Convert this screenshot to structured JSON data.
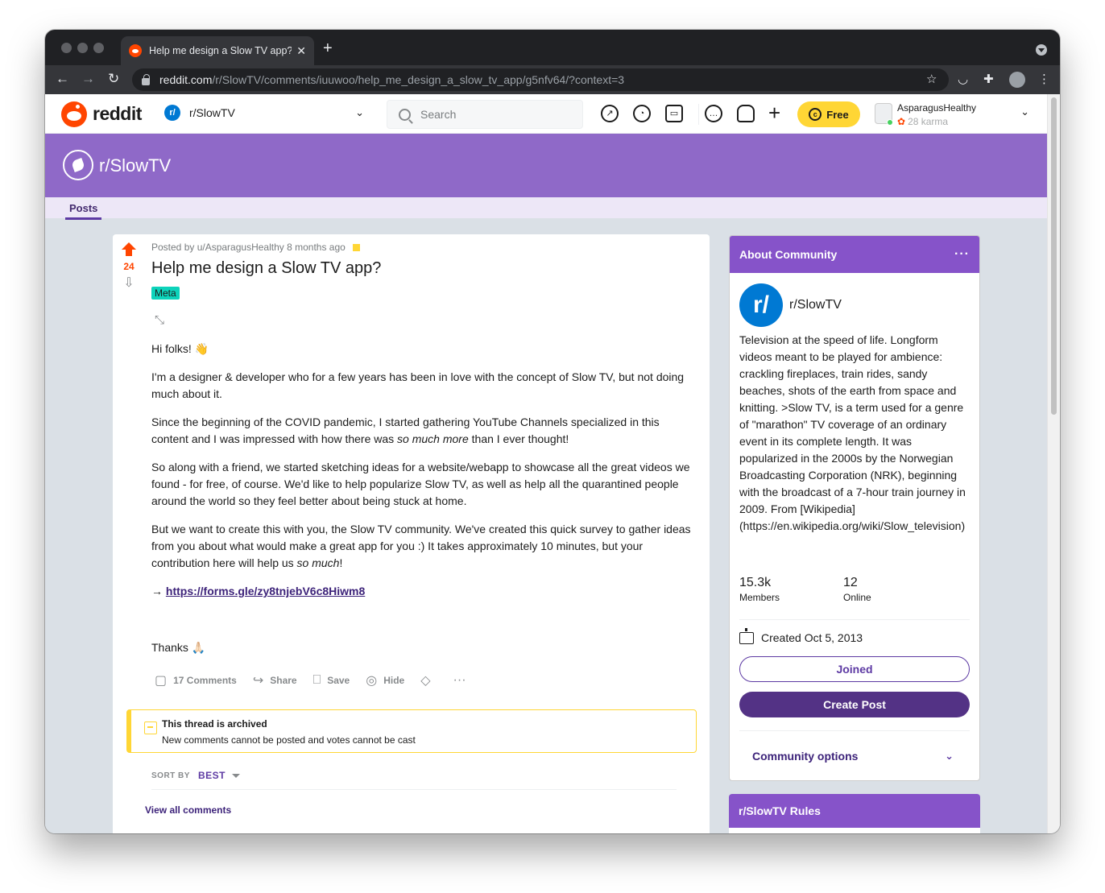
{
  "browser": {
    "tab_title": "Help me design a Slow TV app?",
    "url_host": "reddit.com",
    "url_path": "/r/SlowTV/comments/iuuwoo/help_me_design_a_slow_tv_app/g5nfv64/?context=3"
  },
  "header": {
    "logo_text": "reddit",
    "community": "r/SlowTV",
    "community_icon_letter": "r/",
    "search_placeholder": "Search",
    "premium_label": "Free",
    "username": "AsparagusHealthy",
    "karma": "28 karma",
    "icons": [
      "popular-icon",
      "stats-icon",
      "video-icon",
      "chat-icon",
      "bell-icon",
      "plus-icon",
      "coin-icon"
    ]
  },
  "banner": {
    "name": "r/SlowTV",
    "nav_posts": "Posts",
    "color": "#8f69c8"
  },
  "post": {
    "author_line": "Posted by u/AsparagusHealthy 8 months ago",
    "score": "24",
    "title": "Help me design a Slow TV app?",
    "flair": "Meta",
    "body": {
      "p1": "Hi folks! 👋",
      "p2": "I'm a designer & developer who for a few years has been in love with the concept of Slow TV, but not doing much about it.",
      "p3_a": "Since the beginning of the COVID pandemic, I started gathering YouTube Channels specialized in this content and I was impressed with how there was ",
      "p3_em": "so much more",
      "p3_b": " than I ever thought!",
      "p4": "So along with a friend, we started sketching ideas for a website/webapp to showcase all the great videos we found - for free, of course. We'd like to help popularize Slow TV, as well as help all the quarantined people around the world so they feel better about being stuck at home.",
      "p5_a": "But we want to create this with you, the Slow TV community. We've created this quick survey to gather ideas from you about what would make a great app for you :) It takes approximately 10 minutes, but your contribution here will help us ",
      "p5_em": "so much",
      "p5_b": "!",
      "arrow": "→ ",
      "link": "https://forms.gle/zy8tnjebV6c8Hiwm8",
      "thanks": "Thanks 🙏🏻"
    },
    "actions": {
      "comments": "17 Comments",
      "share": "Share",
      "save": "Save",
      "hide": "Hide"
    },
    "archived_title": "This thread is archived",
    "archived_sub": "New comments cannot be posted and votes cannot be cast",
    "sort_label": "SORT BY",
    "sort_value": "BEST",
    "view_all": "View all comments"
  },
  "sidebar": {
    "about_title": "About Community",
    "community_name": "r/SlowTV",
    "icon_letter": "r/",
    "description": "Television at the speed of life. Longform videos meant to be played for ambience: crackling fireplaces, train rides, sandy beaches, shots of the earth from space and knitting. >Slow TV, is a term used for a genre of \"marathon\" TV coverage of an ordinary event in its complete length. It was popularized in the 2000s by the Norwegian Broadcasting Corporation (NRK), beginning with the broadcast of a 7-hour train journey in 2009. From [Wikipedia](https://en.wikipedia.org/wiki/Slow_television)",
    "members_value": "15.3k",
    "members_label": "Members",
    "online_value": "12",
    "online_label": "Online",
    "created": "Created Oct 5, 2013",
    "joined_label": "Joined",
    "create_post_label": "Create Post",
    "community_options": "Community options",
    "rules_title": "r/SlowTV Rules"
  }
}
